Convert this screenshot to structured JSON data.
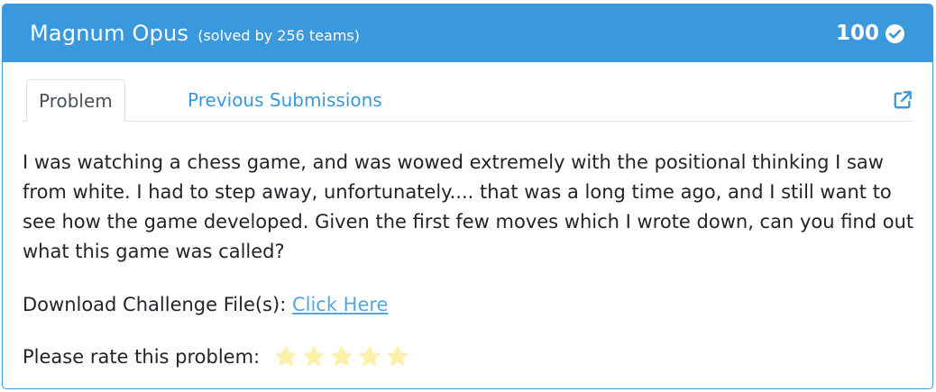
{
  "challenge": {
    "title": "Magnum Opus",
    "solved_text": "(solved by 256 teams)",
    "points": "100"
  },
  "tabs": [
    {
      "label": "Problem",
      "active": true
    },
    {
      "label": "Previous Submissions",
      "active": false
    }
  ],
  "problem": {
    "description": "I was watching a chess game, and was wowed extremely with the positional thinking I saw from white. I had to step away, unfortunately.... that was a long time ago, and I still want to see how the game developed. Given the first few moves which I wrote down, can you find out what this game was called?",
    "download_label": "Download Challenge File(s): ",
    "download_link": "Click Here",
    "rate_label": "Please rate this problem:"
  },
  "rating": {
    "star_count": 5,
    "star_color": "#fdf0a8"
  },
  "colors": {
    "header_bg": "#3a98dc",
    "link": "#5aa5d6"
  },
  "icons": {
    "solved": "check-circle-icon",
    "open_external": "external-link-icon",
    "rating": "star-icon"
  }
}
